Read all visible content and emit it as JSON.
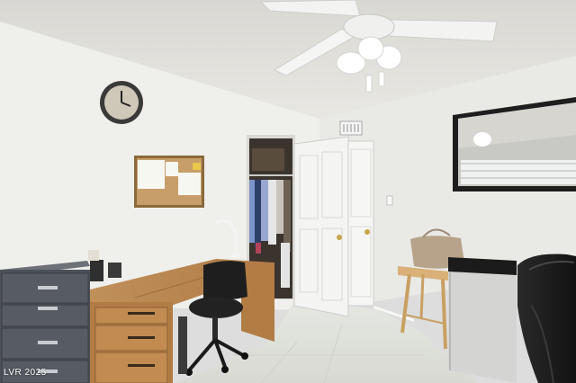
{
  "photo": {
    "watermark": "LVR 2025"
  }
}
